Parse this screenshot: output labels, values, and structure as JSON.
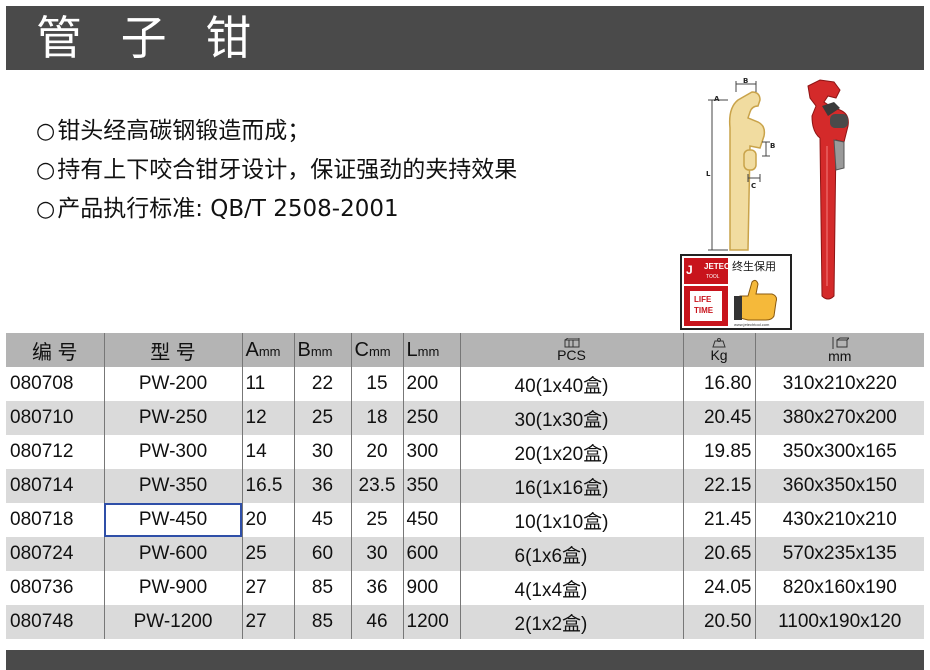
{
  "header": {
    "title": "管 子 钳"
  },
  "features": [
    {
      "bullet": "○",
      "text": "钳头经高碳钢锻造而成；"
    },
    {
      "bullet": "○",
      "text": "持有上下咬合钳牙设计，保证强劲的夹持效果"
    },
    {
      "bullet": "○",
      "text": "产品执行标准: QB/T 2508-2001"
    }
  ],
  "diagram": {
    "label_a": "A",
    "label_b": "B",
    "label_b2": "B",
    "label_c": "C",
    "label_l": "L"
  },
  "badge": {
    "brand": "JETECH",
    "brand_sub": "TOOL",
    "lifetime_top": "LIFE",
    "lifetime_bottom": "TIME",
    "slogan": "终生保用",
    "url": "www.jetechtool.com"
  },
  "table": {
    "headers": {
      "code": "编 号",
      "model": "型 号",
      "a": "A",
      "a_unit": "mm",
      "b": "B",
      "b_unit": "mm",
      "c": "C",
      "c_unit": "mm",
      "l": "L",
      "l_unit": "mm",
      "pcs": "PCS",
      "kg": "Kg",
      "dim": "mm"
    },
    "rows": [
      {
        "code": "080708",
        "model": "PW-200",
        "a": "11",
        "b": "22",
        "c": "15",
        "l": "200",
        "pcs": "40(1x40盒)",
        "kg": "16.80",
        "dim": "310x210x220"
      },
      {
        "code": "080710",
        "model": "PW-250",
        "a": "12",
        "b": "25",
        "c": "18",
        "l": "250",
        "pcs": "30(1x30盒)",
        "kg": "20.45",
        "dim": "380x270x200"
      },
      {
        "code": "080712",
        "model": "PW-300",
        "a": "14",
        "b": "30",
        "c": "20",
        "l": "300",
        "pcs": "20(1x20盒)",
        "kg": "19.85",
        "dim": "350x300x165"
      },
      {
        "code": "080714",
        "model": "PW-350",
        "a": "16.5",
        "b": "36",
        "c": "23.5",
        "l": "350",
        "pcs": "16(1x16盒)",
        "kg": "22.15",
        "dim": "360x350x150"
      },
      {
        "code": "080718",
        "model": "PW-450",
        "a": "20",
        "b": "45",
        "c": "25",
        "l": "450",
        "pcs": "10(1x10盒)",
        "kg": "21.45",
        "dim": "430x210x210"
      },
      {
        "code": "080724",
        "model": "PW-600",
        "a": "25",
        "b": "60",
        "c": "30",
        "l": "600",
        "pcs": "6(1x6盒)",
        "kg": "20.65",
        "dim": "570x235x135"
      },
      {
        "code": "080736",
        "model": "PW-900",
        "a": "27",
        "b": "85",
        "c": "36",
        "l": "900",
        "pcs": "4(1x4盒)",
        "kg": "24.05",
        "dim": "820x160x190"
      },
      {
        "code": "080748",
        "model": "PW-1200",
        "a": "27",
        "b": "85",
        "c": "46",
        "l": "1200",
        "pcs": "2(1x2盒)",
        "kg": "20.50",
        "dim": "1100x190x120"
      }
    ],
    "selected_row": 4
  },
  "colors": {
    "bar": "#4a4a4a",
    "header_row": "#b4b4b4",
    "stripe": "#dadada",
    "wrench_red": "#d42a2a",
    "selection": "#2f4fa8",
    "diagram_gold": "#e8c979"
  }
}
